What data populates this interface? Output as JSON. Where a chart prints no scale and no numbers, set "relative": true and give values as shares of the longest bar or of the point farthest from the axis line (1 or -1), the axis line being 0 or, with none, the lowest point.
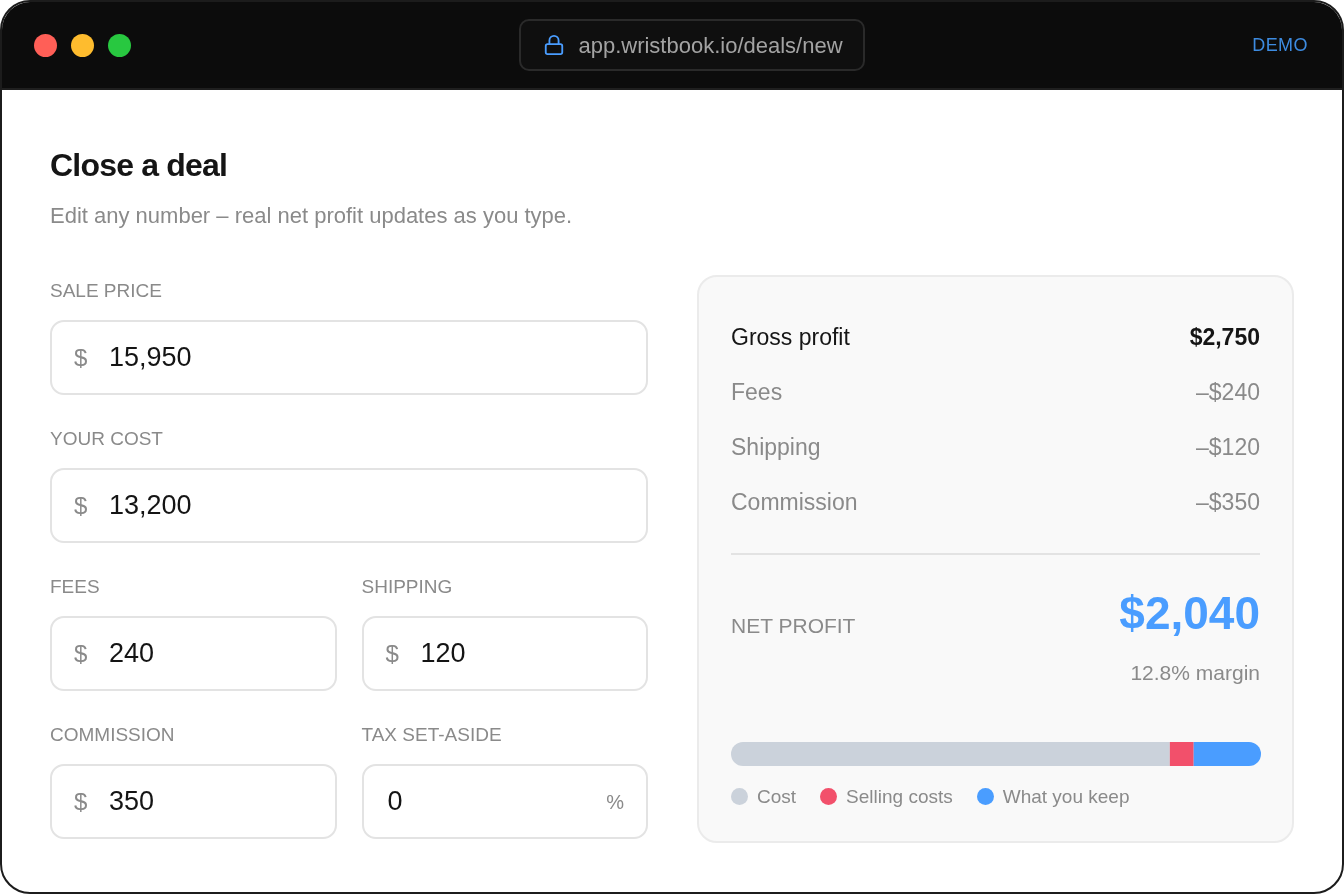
{
  "browser": {
    "address": "app.wristbook.io/deals/new",
    "badge": "DEMO"
  },
  "header": {
    "title": "Close a deal",
    "subtitle": "Edit any number – real net profit updates as you type."
  },
  "form": {
    "rows": [
      {
        "fields": [
          {
            "label": "SALE PRICE",
            "prefix": "$",
            "value": "15,950"
          }
        ]
      },
      {
        "fields": [
          {
            "label": "YOUR COST",
            "prefix": "$",
            "value": "13,200"
          }
        ]
      },
      {
        "fields": [
          {
            "label": "FEES",
            "prefix": "$",
            "value": "240"
          },
          {
            "label": "SHIPPING",
            "prefix": "$",
            "value": "120"
          }
        ]
      },
      {
        "fields": [
          {
            "label": "COMMISSION",
            "prefix": "$",
            "value": "350"
          },
          {
            "label": "TAX SET-ASIDE",
            "value": "0",
            "suffix": "%"
          }
        ]
      }
    ]
  },
  "summary": {
    "lines": [
      {
        "kind": "subtotal",
        "label": "Gross profit",
        "value": "$2,750"
      },
      {
        "kind": "deduction",
        "label": "Fees",
        "value": "–$240"
      },
      {
        "kind": "deduction",
        "label": "Shipping",
        "value": "–$120"
      },
      {
        "kind": "deduction",
        "label": "Commission",
        "value": "–$350"
      }
    ],
    "net": {
      "label": "NET PROFIT",
      "value": "$2,040",
      "margin": "12.8% margin"
    },
    "chart_data": {
      "type": "bar",
      "orientation": "horizontal",
      "stacked": true,
      "relative": true,
      "legend": "bottom",
      "series": [
        {
          "name": "Cost",
          "color": "#cbd2db",
          "values": [
            0.828
          ]
        },
        {
          "name": "Selling costs",
          "color": "#f2506b",
          "values": [
            0.045
          ]
        },
        {
          "name": "What you keep",
          "color": "#4a9dff",
          "values": [
            0.127
          ]
        }
      ]
    }
  }
}
